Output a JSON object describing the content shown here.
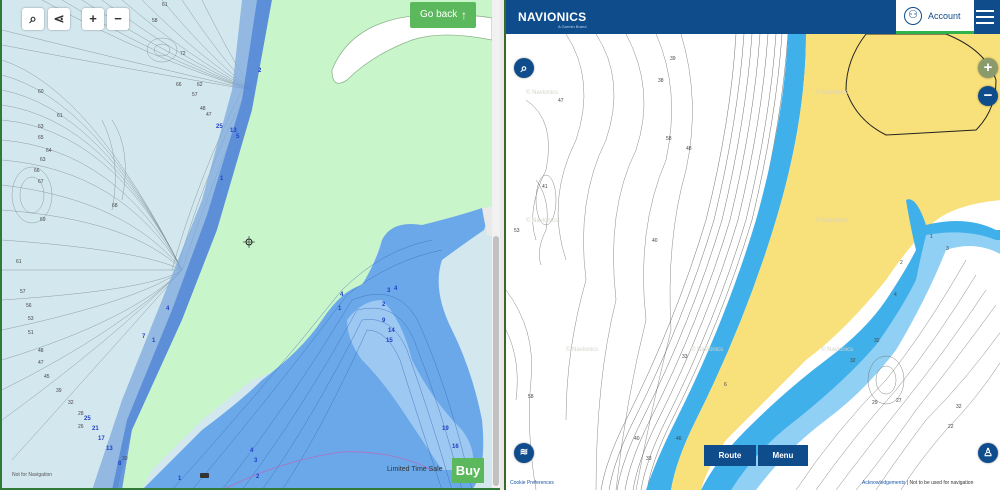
{
  "left_map": {
    "toolbar": {
      "search_icon": "magnifier",
      "share_icon": "share",
      "zoom_in_label": "+",
      "zoom_out_label": "−"
    },
    "go_back_label": "Go back",
    "go_back_icon": "arrow-up",
    "buy_label": "Buy",
    "limited_time_label": "Limited Time Sale",
    "footer_note": "Not for Navigation",
    "depth_labels_black": [
      "61",
      "58",
      "72",
      "62",
      "66",
      "57",
      "60",
      "61",
      "63",
      "65",
      "64",
      "63",
      "66",
      "67",
      "69",
      "68",
      "61",
      "57",
      "56",
      "53",
      "51",
      "48",
      "47",
      "45",
      "39",
      "32",
      "28",
      "26",
      "30",
      "48",
      "47"
    ],
    "depth_labels_blue": [
      "2",
      "25",
      "13",
      "5",
      "1",
      "3",
      "4",
      "4",
      "1",
      "2",
      "9",
      "14",
      "15",
      "19",
      "16",
      "20",
      "25",
      "21",
      "17",
      "13",
      "8",
      "4",
      "3",
      "2",
      "1",
      "4",
      "7",
      "1"
    ]
  },
  "right_map": {
    "brand": "NAVIONICS",
    "brand_sub": "A Garmin Brand",
    "account_label": "Account",
    "watermark": "© Navionics",
    "route_label": "Route",
    "menu_label": "Menu",
    "cookie_label": "Cookie Preferences",
    "acknowledgements_label": "Acknowledgements",
    "not_navigation_label": "Not to be used for navigation",
    "depth_labels": [
      "47",
      "39",
      "38",
      "58",
      "48",
      "41",
      "40",
      "53",
      "33",
      "58",
      "46",
      "40",
      "33",
      "6",
      "22",
      "32",
      "32",
      "29",
      "27",
      "32",
      "1",
      "4",
      "2",
      "3"
    ]
  },
  "colors": {
    "land_left": "#c8f5c9",
    "water_left": "#d3e7ee",
    "deep_blue": "#5aa0e8",
    "land_right": "#f8e07a",
    "water_right": "#ffffff",
    "shore_blue": "#3fb0ea",
    "brand_blue": "#0f4c8c",
    "buy_green": "#5cb85c"
  }
}
